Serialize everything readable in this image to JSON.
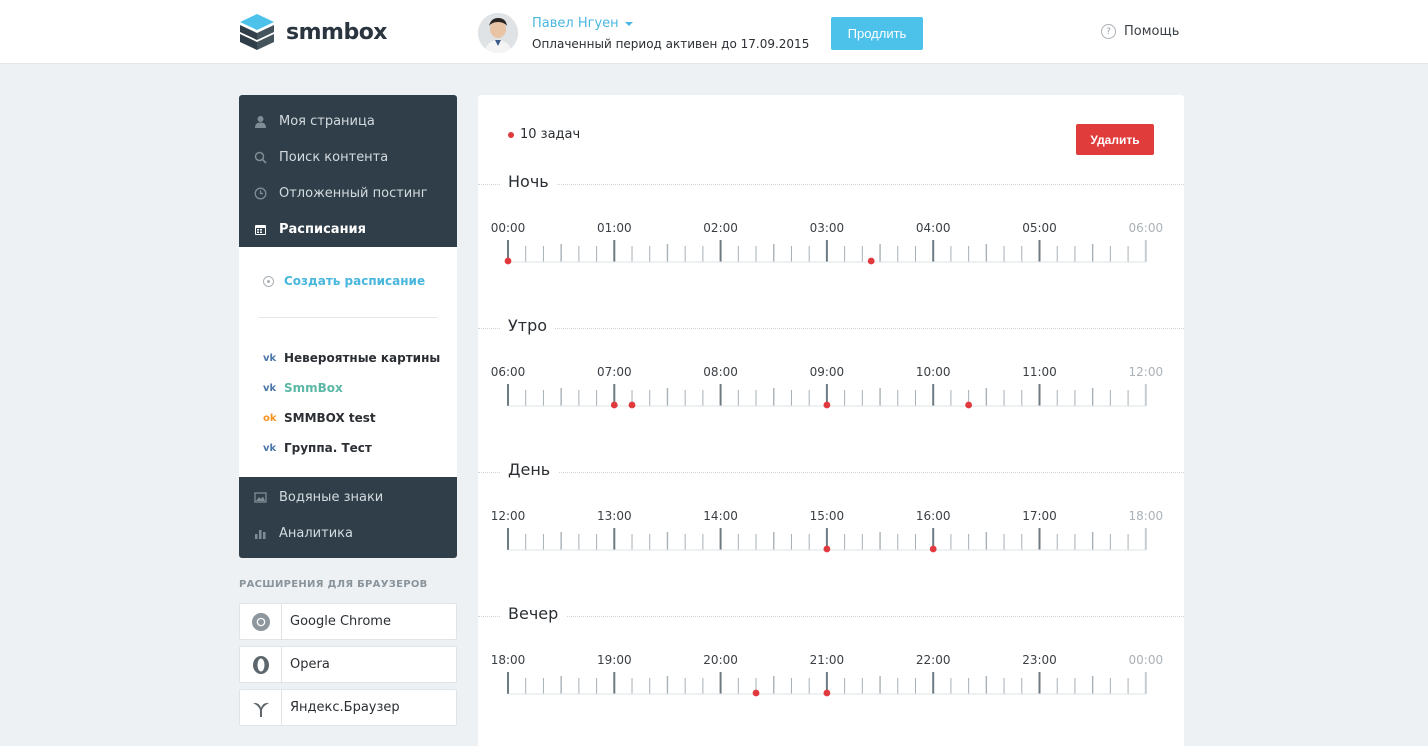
{
  "header": {
    "logo_text": "smmbox",
    "user_name": "Павел Нгуен",
    "period_text": "Оплаченный период активен до 17.09.2015",
    "extend_label": "Продлить",
    "help_label": "Помощь",
    "help_icon_glyph": "?"
  },
  "sidebar": {
    "nav_top": [
      {
        "label": "Моя страница",
        "icon": "user-icon"
      },
      {
        "label": "Поиск контента",
        "icon": "search-icon"
      },
      {
        "label": "Отложенный постинг",
        "icon": "clock-icon"
      },
      {
        "label": "Расписания",
        "icon": "calendar-icon",
        "active": true
      }
    ],
    "create_label": "Создать расписание",
    "groups": [
      {
        "label": "Невероятные картины",
        "network": "vk",
        "network_glyph": "vk"
      },
      {
        "label": "SmmBox",
        "network": "vk",
        "network_glyph": "vk",
        "active": true
      },
      {
        "label": "SMMBOX test",
        "network": "ok",
        "network_glyph": "ok"
      },
      {
        "label": "Группа. Тест",
        "network": "vk",
        "network_glyph": "vk"
      }
    ],
    "nav_bottom": [
      {
        "label": "Водяные знаки",
        "icon": "image-icon"
      },
      {
        "label": "Аналитика",
        "icon": "bar-chart-icon"
      }
    ],
    "extensions_title": "РАСШИРЕНИЯ ДЛЯ БРАУЗЕРОВ",
    "extensions": [
      {
        "label": "Google Chrome",
        "icon": "chrome-icon"
      },
      {
        "label": "Opera",
        "icon": "opera-icon"
      },
      {
        "label": "Яндекс.Браузер",
        "icon": "yandex-browser-icon"
      }
    ]
  },
  "main": {
    "tasks_label": "10 задач",
    "delete_label": "Удалить",
    "accent_color": "#e0393e",
    "sections": [
      {
        "title": "Ночь",
        "hours": [
          "00:00",
          "01:00",
          "02:00",
          "03:00",
          "04:00",
          "05:00",
          "06:00"
        ],
        "tasks": [
          "00:00",
          "03:25"
        ]
      },
      {
        "title": "Утро",
        "hours": [
          "06:00",
          "07:00",
          "08:00",
          "09:00",
          "10:00",
          "11:00",
          "12:00"
        ],
        "tasks": [
          "07:00",
          "07:10",
          "09:00",
          "10:20"
        ]
      },
      {
        "title": "День",
        "hours": [
          "12:00",
          "13:00",
          "14:00",
          "15:00",
          "16:00",
          "17:00",
          "18:00"
        ],
        "tasks": [
          "15:00",
          "16:00"
        ]
      },
      {
        "title": "Вечер",
        "hours": [
          "18:00",
          "19:00",
          "20:00",
          "21:00",
          "22:00",
          "23:00",
          "00:00"
        ],
        "tasks": [
          "20:20",
          "21:00"
        ]
      }
    ]
  }
}
